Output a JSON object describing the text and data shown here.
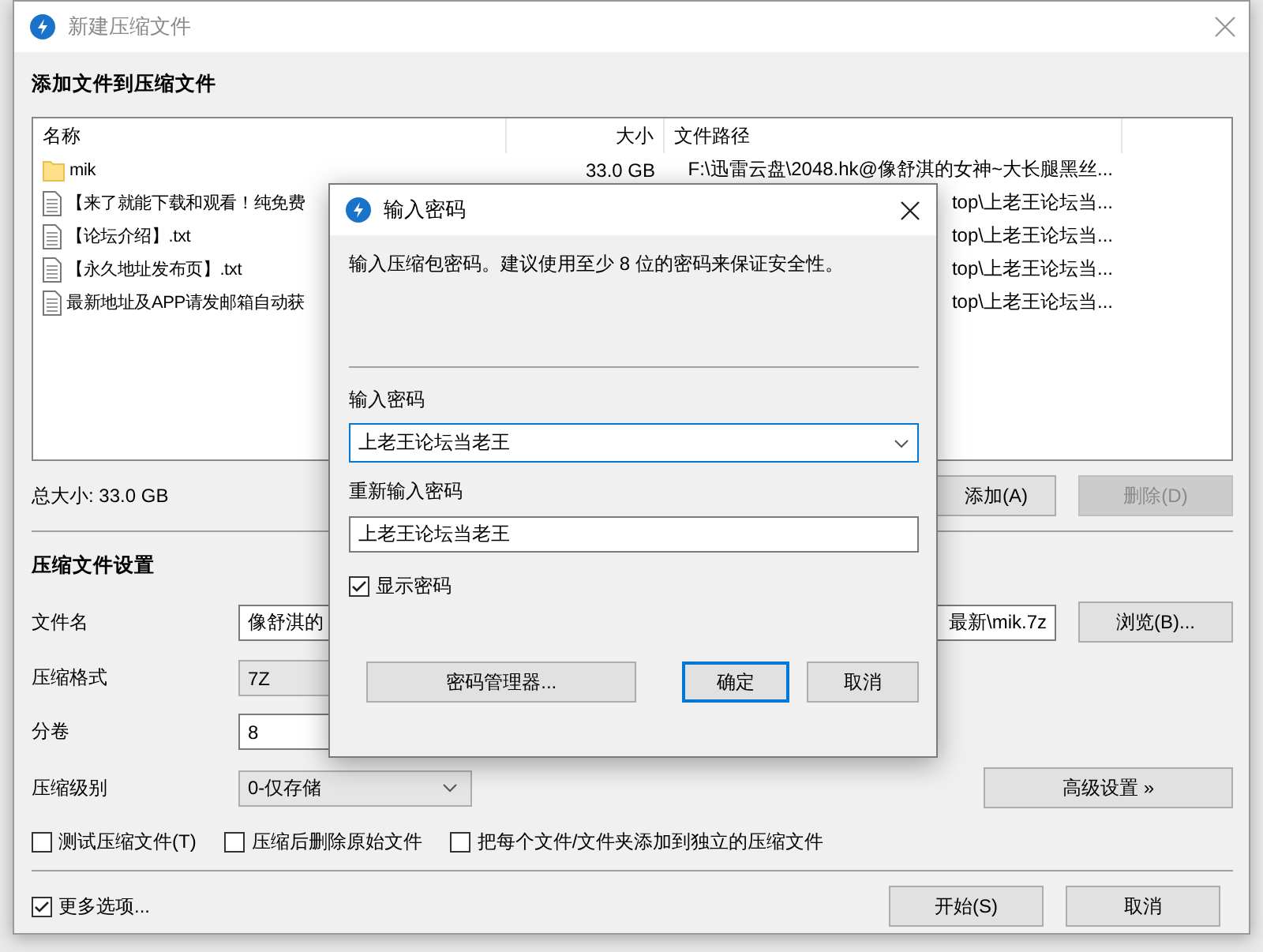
{
  "window": {
    "title": "新建压缩文件",
    "active": false
  },
  "file_list": {
    "heading": "添加文件到压缩文件",
    "columns": [
      "名称",
      "大小",
      "文件路径"
    ],
    "rows": [
      {
        "kind": "folder",
        "name": "mik",
        "size": "33.0 GB",
        "path": "F:\\迅雷云盘\\2048.hk@像舒淇的女神~大长腿黑丝..."
      },
      {
        "kind": "file",
        "name": "【来了就能下载和观看！纯免费",
        "path": "top\\上老王论坛当..."
      },
      {
        "kind": "file",
        "name": "【论坛介绍】.txt",
        "path": "top\\上老王论坛当..."
      },
      {
        "kind": "file",
        "name": "【永久地址发布页】.txt",
        "path": "top\\上老王论坛当..."
      },
      {
        "kind": "file",
        "name": "最新地址及APP请发邮箱自动获",
        "path": "top\\上老王论坛当..."
      }
    ]
  },
  "total_size": "总大小: 33.0 GB",
  "list_buttons": [
    {
      "label": "添加(A)",
      "disabled": false
    },
    {
      "label": "删除(D)",
      "disabled": true
    }
  ],
  "settings": {
    "heading": "压缩文件设置",
    "fields": [
      {
        "kind": "path",
        "label": "文件名",
        "value_start": "像舒淇的",
        "value_end": "最新\\mik.7z",
        "button": "浏览(B)..."
      },
      {
        "kind": "combo",
        "label": "压缩格式",
        "value": "7Z"
      },
      {
        "kind": "text",
        "label": "分卷",
        "value": "8"
      },
      {
        "kind": "combo",
        "label": "压缩级别",
        "value": "0-仅存储",
        "button": "高级设置 »"
      }
    ],
    "options": [
      {
        "label": "测试压缩文件(T)",
        "checked": false
      },
      {
        "label": "压缩后删除原始文件",
        "checked": false
      },
      {
        "label": "把每个文件/文件夹添加到独立的压缩文件",
        "checked": false
      }
    ]
  },
  "more_options": {
    "label": "更多选项...",
    "checked": true
  },
  "footer_buttons": [
    "开始(S)",
    "取消"
  ],
  "dialog": {
    "title": "输入密码",
    "message": "输入压缩包密码。建议使用至少 8 位的密码来保证安全性。",
    "password_label": "输入密码",
    "password": "上老王论坛当老王",
    "confirm_label": "重新输入密码",
    "confirm": "上老王论坛当老王",
    "show_password": {
      "label": "显示密码",
      "checked": true
    },
    "buttons": [
      {
        "label": "密码管理器...",
        "default": false
      },
      {
        "label": "确定",
        "default": true
      },
      {
        "label": "取消",
        "default": false
      }
    ]
  }
}
